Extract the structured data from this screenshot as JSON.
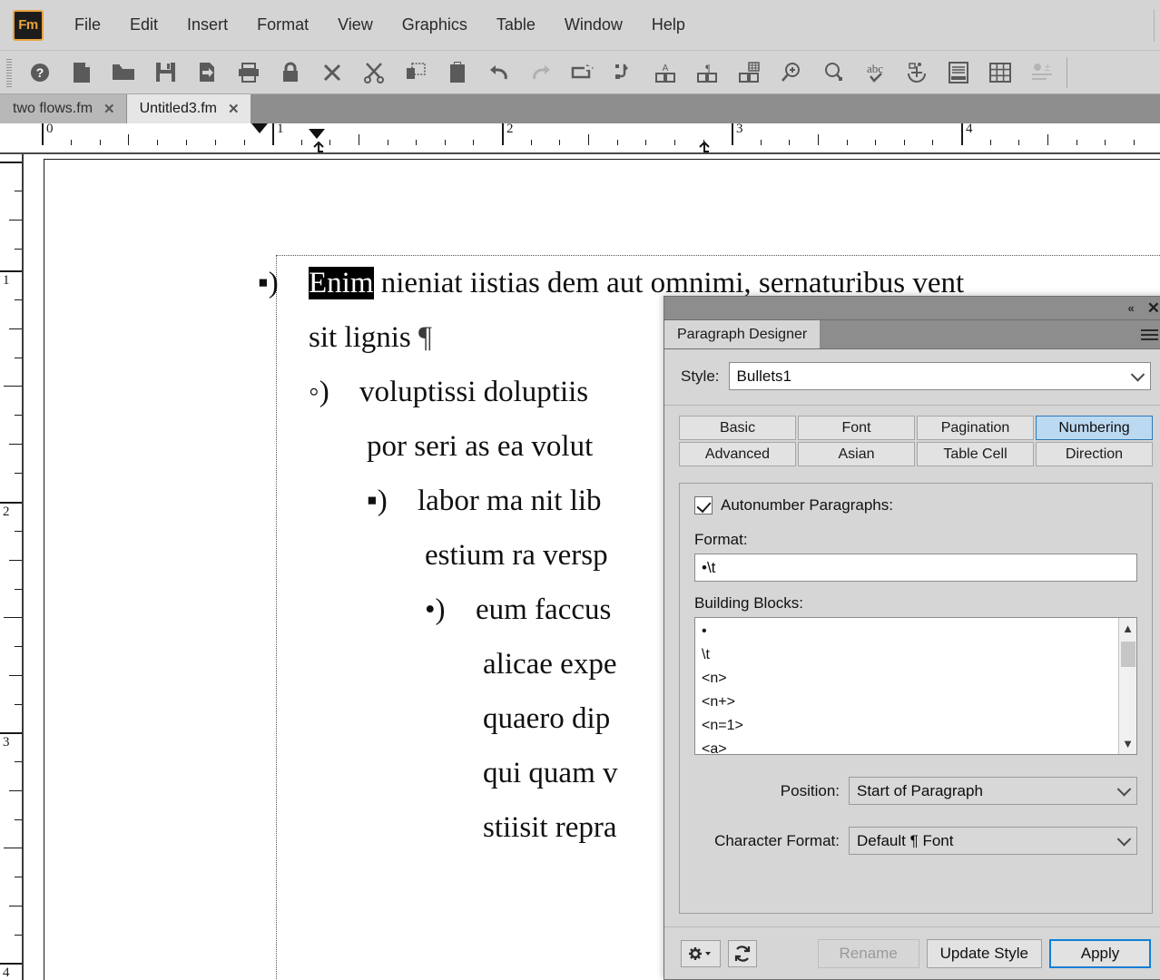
{
  "app": {
    "name": "Adobe FrameMaker",
    "logo_text": "Fm"
  },
  "menubar": {
    "items": [
      {
        "label": "File"
      },
      {
        "label": "Edit"
      },
      {
        "label": "Insert"
      },
      {
        "label": "Format"
      },
      {
        "label": "View"
      },
      {
        "label": "Graphics"
      },
      {
        "label": "Table"
      },
      {
        "label": "Window"
      },
      {
        "label": "Help"
      }
    ]
  },
  "toolbar": {
    "buttons": [
      {
        "icon": "help-icon",
        "enabled": true
      },
      {
        "icon": "new-document-icon",
        "enabled": true
      },
      {
        "icon": "open-folder-icon",
        "enabled": true
      },
      {
        "icon": "save-icon",
        "enabled": true
      },
      {
        "icon": "save-as-icon",
        "enabled": true
      },
      {
        "icon": "print-icon",
        "enabled": true
      },
      {
        "icon": "lock-icon",
        "enabled": true
      },
      {
        "icon": "close-x-icon",
        "enabled": true
      },
      {
        "icon": "cut-scissors-icon",
        "enabled": true
      },
      {
        "icon": "copy-icon",
        "enabled": true
      },
      {
        "icon": "paste-clipboard-icon",
        "enabled": true
      },
      {
        "icon": "undo-icon",
        "enabled": true
      },
      {
        "icon": "redo-icon",
        "enabled": false
      },
      {
        "icon": "redo-arrow-icon",
        "enabled": true
      },
      {
        "icon": "find-change-icon",
        "enabled": true
      },
      {
        "icon": "character-designer-icon",
        "enabled": true
      },
      {
        "icon": "paragraph-designer-icon",
        "enabled": true
      },
      {
        "icon": "table-designer-icon",
        "enabled": true
      },
      {
        "icon": "zoom-in-icon",
        "enabled": true
      },
      {
        "icon": "zoom-out-icon",
        "enabled": true
      },
      {
        "icon": "spell-check-icon",
        "enabled": true
      },
      {
        "icon": "anchored-frame-icon",
        "enabled": true
      },
      {
        "icon": "text-frame-icon",
        "enabled": true
      },
      {
        "icon": "insert-table-icon",
        "enabled": true
      },
      {
        "icon": "insert-object-icon",
        "enabled": false
      }
    ]
  },
  "doctabs": {
    "items": [
      {
        "label": "two flows.fm",
        "close": "✕",
        "active": false
      },
      {
        "label": "Untitled3.fm",
        "close": "✕",
        "active": true
      }
    ]
  },
  "rulers": {
    "horizontal_labels": [
      "0",
      "1",
      "2",
      "3",
      "4"
    ],
    "vertical_labels": [
      "1",
      "2",
      "3",
      "4"
    ],
    "tab_stop_glyph": "⦿"
  },
  "document": {
    "lines": [
      {
        "bullet": "▪)",
        "indent": 0,
        "text_before": "",
        "selected": "Enim",
        "text_after": " nieniat iistias dem aut omnimi, sernaturibus vent",
        "pilcrow": false
      },
      {
        "bullet": "",
        "indent": 56,
        "text_before": "sit lignis ",
        "selected": "",
        "text_after": "",
        "pilcrow": true
      },
      {
        "bullet": "◦)",
        "indent": 56,
        "text_before": "voluptissi doluptiis",
        "selected": "",
        "text_after": "",
        "pilcrow": false
      },
      {
        "bullet": "",
        "indent": 120,
        "text_before": "por seri as ea volut",
        "selected": "",
        "text_after": "",
        "pilcrow": false
      },
      {
        "bullet": "▪)",
        "indent": 120,
        "text_before": "labor ma nit lib",
        "selected": "",
        "text_after": "",
        "pilcrow": false
      },
      {
        "bullet": "",
        "indent": 184,
        "text_before": "estium ra versp",
        "selected": "",
        "text_after": "",
        "pilcrow": false
      },
      {
        "bullet": "•)",
        "indent": 184,
        "text_before": "eum faccus",
        "selected": "",
        "text_after": "",
        "pilcrow": false
      },
      {
        "bullet": "",
        "indent": 248,
        "text_before": "alicae expe",
        "selected": "",
        "text_after": "",
        "pilcrow": false
      },
      {
        "bullet": "",
        "indent": 248,
        "text_before": "quaero dip",
        "selected": "",
        "text_after": "",
        "pilcrow": false
      },
      {
        "bullet": "",
        "indent": 248,
        "text_before": "qui quam v",
        "selected": "",
        "text_after": "",
        "pilcrow": false
      },
      {
        "bullet": "",
        "indent": 248,
        "text_before": "stiisit repra",
        "selected": "",
        "text_after": "",
        "pilcrow": false
      }
    ]
  },
  "paragraph_designer": {
    "panel_title": "Paragraph Designer",
    "collapse_glyph": "«",
    "close_glyph": "✕",
    "style_label": "Style:",
    "style_value": "Bullets1",
    "property_tabs": [
      {
        "label": "Basic",
        "selected": false
      },
      {
        "label": "Font",
        "selected": false
      },
      {
        "label": "Pagination",
        "selected": false
      },
      {
        "label": "Numbering",
        "selected": true
      },
      {
        "label": "Advanced",
        "selected": false
      },
      {
        "label": "Asian",
        "selected": false
      },
      {
        "label": "Table Cell",
        "selected": false
      },
      {
        "label": "Direction",
        "selected": false
      }
    ],
    "autonumber_label": "Autonumber Paragraphs:",
    "autonumber_checked": true,
    "format_label": "Format:",
    "format_value": "•\\t",
    "building_blocks_label": "Building Blocks:",
    "building_blocks": [
      "•",
      "\\t",
      "<n>",
      "<n+>",
      "<n=1>",
      "<a>"
    ],
    "position_label": "Position:",
    "position_value": "Start of Paragraph",
    "character_format_label": "Character Format:",
    "character_format_value": "Default ¶ Font",
    "footer": {
      "settings_icon": "gear-dropdown-icon",
      "refresh_icon": "refresh-icon",
      "rename_label": "Rename",
      "rename_enabled": false,
      "update_style_label": "Update Style",
      "apply_label": "Apply"
    }
  },
  "colors": {
    "chrome": "#d4d4d4",
    "tabstrip": "#8e8e8e",
    "panel_bg": "#d6d6d6",
    "accent_selected_tab": "#bcd9f2",
    "accent_border": "#2a7ab8",
    "primary_button_border": "#0f7ed6",
    "logo_orange": "#e8a33d"
  }
}
